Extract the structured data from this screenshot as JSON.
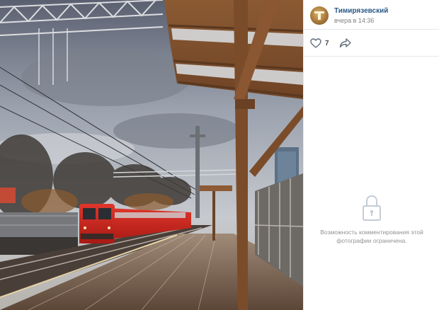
{
  "post": {
    "author": "Тимирязевский",
    "date": "вчера в 14:36",
    "likes": "7"
  },
  "comments": {
    "restricted_text": "Возможность комментирования этой фотографии ограничена."
  },
  "icons": {
    "like": "heart-icon",
    "share": "share-arrow-icon",
    "lock": "lock-icon"
  },
  "colors": {
    "author_link": "#2a5885",
    "muted_text": "#828282",
    "divider": "#e7e8ec",
    "train_red": "#c8231d"
  }
}
